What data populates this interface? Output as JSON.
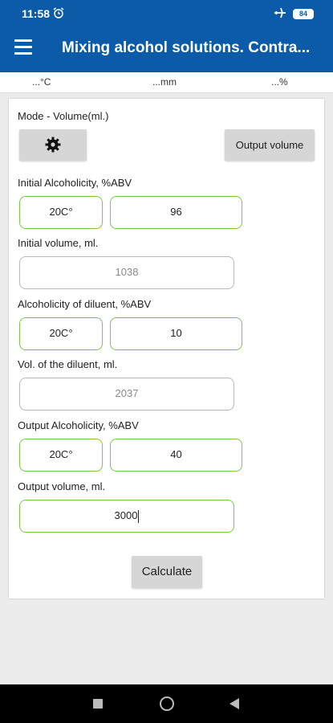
{
  "status_bar": {
    "time": "11:58",
    "battery": "84"
  },
  "app_bar": {
    "title": "Mixing alcohol solutions. Contra..."
  },
  "sensors": {
    "temperature": "...°C",
    "pressure": "...mm",
    "humidity": "...%"
  },
  "form": {
    "mode_label": "Mode - Volume(ml.)",
    "output_volume_button": "Output volume",
    "initial_alcoholicity": {
      "label": "Initial Alcoholicity, %ABV",
      "temperature": "20C°",
      "value": "96"
    },
    "initial_volume": {
      "label": "Initial volume, ml.",
      "value": "1038"
    },
    "diluent_alcoholicity": {
      "label": "Alcoholicity of diluent, %ABV",
      "temperature": "20C°",
      "value": "10"
    },
    "diluent_volume": {
      "label": "Vol. of the diluent, ml.",
      "value": "2037"
    },
    "output_alcoholicity": {
      "label": "Output  Alcoholicity, %ABV",
      "temperature": "20C°",
      "value": "40"
    },
    "output_volume": {
      "label": "Output volume, ml.",
      "value": "3000"
    },
    "calculate_button": "Calculate"
  },
  "colors": {
    "primary": "#0b5ba8",
    "accent_border": "#7dc84b",
    "inactive_border": "#b8b8b8"
  }
}
